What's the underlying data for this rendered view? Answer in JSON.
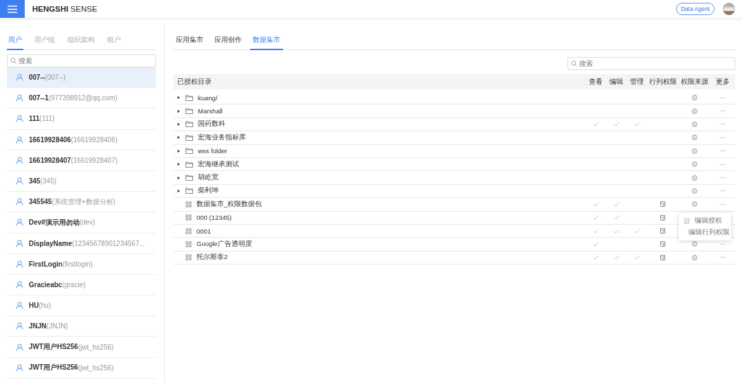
{
  "header": {
    "logo": "**HENGSHI** SENSE",
    "agent_button": "Data Agent"
  },
  "left_tabs": [
    {
      "label": "用户",
      "selected": true
    },
    {
      "label": "用户组",
      "selected": false
    },
    {
      "label": "组织架构",
      "selected": false
    },
    {
      "label": "租户",
      "selected": false
    }
  ],
  "user_search": {
    "placeholder": "搜索"
  },
  "users": [
    {
      "name": "007--",
      "id": "(007--)",
      "selected": true
    },
    {
      "name": "007--1",
      "id": "(977398912@qq.com)",
      "selected": false
    },
    {
      "name": "111",
      "id": "(111)",
      "selected": false
    },
    {
      "name": "16619928406",
      "id": "(16619928406)",
      "selected": false
    },
    {
      "name": "16619928407",
      "id": "(16619928407)",
      "selected": false
    },
    {
      "name": "345",
      "id": "(345)",
      "selected": false
    },
    {
      "name": "345545",
      "id": "(系统管理+数据分析)",
      "selected": false
    },
    {
      "name": "Dev#演示用勿动",
      "id": "(dev)",
      "selected": false
    },
    {
      "name": "DisplayName",
      "id": "(12345678901234567...",
      "selected": false
    },
    {
      "name": "FirstLogin",
      "id": "(firstlogin)",
      "selected": false
    },
    {
      "name": "Gracieabc",
      "id": "(gracie)",
      "selected": false
    },
    {
      "name": "HU",
      "id": "(hu)",
      "selected": false
    },
    {
      "name": "JNJN",
      "id": "(JNJN)",
      "selected": false
    },
    {
      "name": "JWT用户HS256",
      "id": "(jwt_hs256)",
      "selected": false
    },
    {
      "name": "JWT用户HS256",
      "id": "(jwt_hs256)",
      "selected": false
    }
  ],
  "main_tabs": [
    {
      "label": "应用集市",
      "selected": false
    },
    {
      "label": "应用创作",
      "selected": false
    },
    {
      "label": "数据集市",
      "selected": true
    }
  ],
  "table_search": {
    "placeholder": "搜索"
  },
  "table": {
    "columns": [
      "已授权目录",
      "查看",
      "编辑",
      "管理",
      "行列权限",
      "权限来源",
      "更多"
    ],
    "rows": [
      {
        "kind": "folder",
        "name": "kuang/",
        "view": false,
        "edit": false,
        "manage": false,
        "row_column": false,
        "more": "···"
      },
      {
        "kind": "folder",
        "name": "Marshall",
        "view": false,
        "edit": false,
        "manage": false,
        "row_column": false,
        "more": "···"
      },
      {
        "kind": "folder",
        "name": "国药数科",
        "view": true,
        "edit": true,
        "manage": true,
        "row_column": false,
        "more": "···"
      },
      {
        "kind": "folder",
        "name": "宏海业务指标库",
        "view": false,
        "edit": false,
        "manage": false,
        "row_column": false,
        "more": "···"
      },
      {
        "kind": "folder",
        "name": "wss folder",
        "view": false,
        "edit": false,
        "manage": false,
        "row_column": false,
        "more": "···"
      },
      {
        "kind": "folder",
        "name": "宏海继承测试",
        "view": false,
        "edit": false,
        "manage": false,
        "row_column": false,
        "more": "···"
      },
      {
        "kind": "folder",
        "name": "胡屹宽",
        "view": false,
        "edit": false,
        "manage": false,
        "row_column": false,
        "more": "···"
      },
      {
        "kind": "folder",
        "name": "柴利坤",
        "view": false,
        "edit": false,
        "manage": false,
        "row_column": false,
        "more": "···"
      },
      {
        "kind": "dataset",
        "name": "数据集市_权限数据包",
        "view": true,
        "edit": true,
        "manage": false,
        "row_column": true,
        "more": "···"
      },
      {
        "kind": "dataset",
        "name": "000 (12345)",
        "view": true,
        "edit": true,
        "manage": false,
        "row_column": true
      },
      {
        "kind": "dataset",
        "name": "0001",
        "view": true,
        "edit": true,
        "manage": true,
        "row_column": true
      },
      {
        "kind": "dataset",
        "name": "Google广告透明度",
        "view": true,
        "edit": false,
        "manage": false,
        "row_column": true,
        "more": "···"
      },
      {
        "kind": "dataset",
        "name": "托尔斯泰2",
        "view": true,
        "edit": true,
        "manage": true,
        "row_column": true,
        "more": "···"
      }
    ]
  },
  "context_menu": {
    "items": [
      "编辑授权",
      "编辑行列权限"
    ]
  }
}
